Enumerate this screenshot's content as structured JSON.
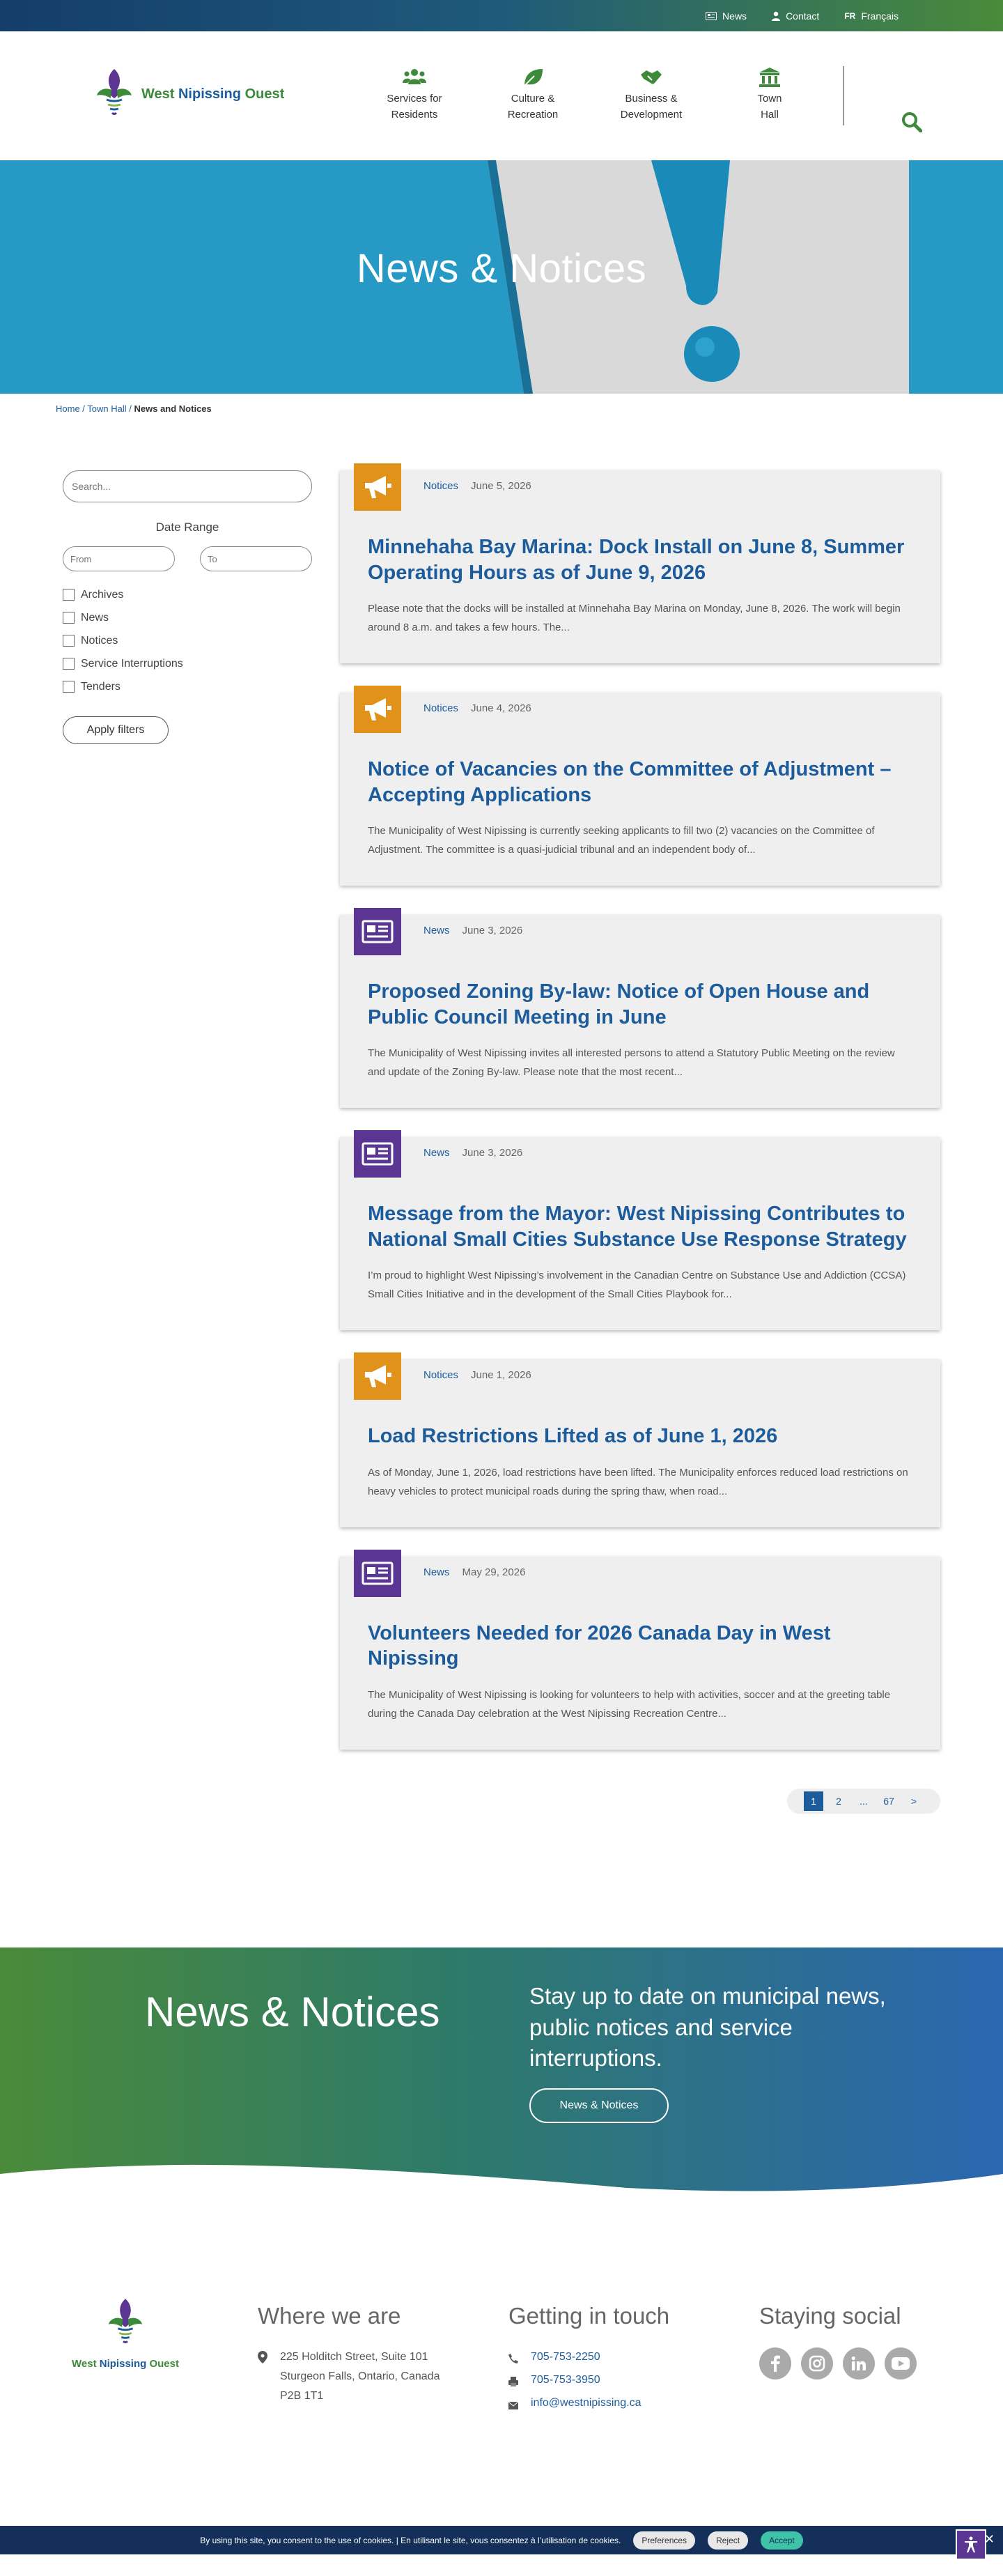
{
  "topbar": {
    "news": "News",
    "contact": "Contact",
    "lang_code": "FR",
    "lang_label": "Français"
  },
  "header": {
    "logo_word1": "West",
    "logo_word2": "Nipissing",
    "logo_word3": "Ouest",
    "nav": [
      {
        "line1": "Services for",
        "line2": "Residents",
        "icon": "people-icon"
      },
      {
        "line1": "Culture &",
        "line2": "Recreation",
        "icon": "leaf-icon"
      },
      {
        "line1": "Business &",
        "line2": "Development",
        "icon": "handshake-icon"
      },
      {
        "line1": "Town",
        "line2": "Hall",
        "icon": "town-hall-icon"
      }
    ]
  },
  "hero": {
    "title": "News & Notices"
  },
  "breadcrumb": {
    "home": "Home",
    "sep1": " / ",
    "town_hall": "Town Hall",
    "sep2": " / ",
    "current": "News and Notices"
  },
  "sidebar": {
    "search_placeholder": "Search...",
    "date_range": "Date Range",
    "from_placeholder": "From",
    "to_placeholder": "To",
    "filters": [
      "Archives",
      "News",
      "Notices",
      "Service Interruptions",
      "Tenders"
    ],
    "apply": "Apply filters"
  },
  "articles": [
    {
      "category": "Notices",
      "type": "notices",
      "date": "June 5, 2026",
      "title": "Minnehaha Bay Marina: Dock Install on June 8, Summer Operating Hours as of June 9, 2026",
      "excerpt": "Please note that the docks will be installed at Minnehaha Bay Marina on Monday, June 8, 2026. The work will begin around 8 a.m. and takes a few hours. The..."
    },
    {
      "category": "Notices",
      "type": "notices",
      "date": "June 4, 2026",
      "title": "Notice of Vacancies on the Committee of Adjustment – Accepting Applications",
      "excerpt": "The Municipality of West Nipissing is currently seeking applicants to fill two (2) vacancies on the Committee of Adjustment. The committee is a quasi-judicial tribunal and an independent body of..."
    },
    {
      "category": "News",
      "type": "news",
      "date": "June 3, 2026",
      "title": "Proposed Zoning By-law: Notice of Open House and Public Council Meeting in June",
      "excerpt": "The Municipality of West Nipissing invites all interested persons to attend a Statutory Public Meeting on the review and update of the Zoning By-law. Please note that the most recent..."
    },
    {
      "category": "News",
      "type": "news",
      "date": "June 3, 2026",
      "title": "Message from the Mayor: West Nipissing Contributes to National Small Cities Substance Use Response Strategy",
      "excerpt": "I’m proud to highlight West Nipissing’s involvement in the Canadian Centre on Substance Use and Addiction (CCSA) Small Cities Initiative and in the development of the Small Cities Playbook for..."
    },
    {
      "category": "Notices",
      "type": "notices",
      "date": "June 1, 2026",
      "title": "Load Restrictions Lifted as of June 1, 2026",
      "excerpt": "As of Monday, June 1, 2026, load restrictions have been lifted. The Municipality enforces reduced load restrictions on heavy vehicles to protect municipal roads during the spring thaw, when road..."
    },
    {
      "category": "News",
      "type": "news",
      "date": "May 29, 2026",
      "title": "Volunteers Needed for 2026 Canada Day in West Nipissing",
      "excerpt": "The Municipality of West Nipissing is looking for volunteers to help with activities, soccer and at the greeting table during the Canada Day celebration at the West Nipissing Recreation Centre..."
    }
  ],
  "pagination": {
    "pages": [
      "1",
      "2",
      "...",
      "67",
      ">"
    ],
    "current": "1"
  },
  "cta": {
    "title": "News & Notices",
    "text": "Stay up to date on municipal news, public notices and service interruptions.",
    "button": "News & Notices"
  },
  "footer": {
    "where_title": "Where we are",
    "address1": "225 Holditch Street, Suite 101",
    "address2": "Sturgeon Falls, Ontario, Canada",
    "address3": "P2B 1T1",
    "touch_title": "Getting in touch",
    "phone": "705-753-2250",
    "fax": "705-753-3950",
    "email": "info@westnipissing.ca",
    "social_title": "Staying social",
    "socials": [
      "facebook-icon",
      "instagram-icon",
      "linkedin-icon",
      "youtube-icon"
    ]
  },
  "cookie": {
    "text": "By using this site, you consent to the use of cookies. | En utilisant le site, vous consentez à l’utilisation de cookies.",
    "preferences": "Preferences",
    "reject": "Reject",
    "accept": "Accept"
  },
  "colors": {
    "brand_blue": "#1d5c9c",
    "brand_green": "#3c8a3a",
    "notices_orange": "#e0921a",
    "news_purple": "#5a3591"
  }
}
